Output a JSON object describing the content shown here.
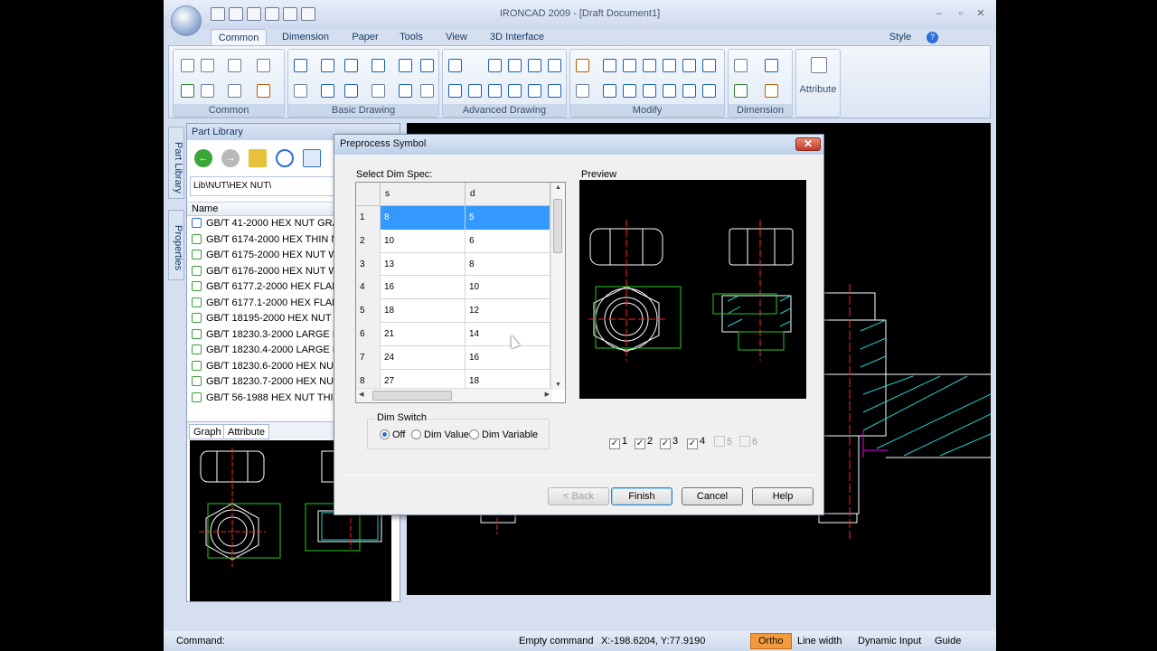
{
  "window": {
    "title": "IRONCAD 2009 - [Draft Document1]"
  },
  "ribbon": {
    "tabs": [
      "Common",
      "Dimension",
      "Paper",
      "Tools",
      "View",
      "3D Interface"
    ],
    "style_label": "Style",
    "groups": [
      "Common",
      "Basic Drawing",
      "Advanced Drawing",
      "Modify",
      "Dimension"
    ],
    "attribute_label": "Attribute"
  },
  "side_tabs": [
    "Part Library",
    "Properties"
  ],
  "part_library": {
    "title": "Part Library",
    "path": "Lib\\NUT\\HEX NUT\\",
    "column": "Name",
    "items": [
      "GB/T 41-2000 HEX NUT GRA",
      "GB/T 6174-2000 HEX THIN N",
      "GB/T 6175-2000 HEX NUT W",
      "GB/T 6176-2000 HEX NUT W",
      "GB/T 6177.2-2000 HEX FLAN",
      "GB/T 6177.1-2000 HEX FLAN",
      "GB/T 18195-2000 HEX NUT I",
      "GB/T 18230.3-2000 LARGE H",
      "GB/T 18230.4-2000 LARGE H",
      "GB/T 18230.6-2000 HEX NUT",
      "GB/T 18230.7-2000 HEX NUT",
      "GB/T 56-1988 HEX NUT THI"
    ],
    "bottom_tabs": [
      "Graph",
      "Attribute"
    ]
  },
  "dialog": {
    "title": "Preprocess Symbol",
    "close_glyph": "✕",
    "select_label": "Select Dim Spec:",
    "preview_label": "Preview",
    "columns": [
      "s",
      "d"
    ],
    "rows": [
      {
        "n": "1",
        "s": "8",
        "d": "5"
      },
      {
        "n": "2",
        "s": "10",
        "d": "6"
      },
      {
        "n": "3",
        "s": "13",
        "d": "8"
      },
      {
        "n": "4",
        "s": "16",
        "d": "10"
      },
      {
        "n": "5",
        "s": "18",
        "d": "12"
      },
      {
        "n": "6",
        "s": "21",
        "d": "14"
      },
      {
        "n": "7",
        "s": "24",
        "d": "16"
      },
      {
        "n": "8",
        "s": "27",
        "d": "18"
      }
    ],
    "dim_switch": {
      "label": "Dim Switch",
      "options": [
        "Off",
        "Dim Value",
        "Dim Variable"
      ],
      "selected": "Off"
    },
    "checks": [
      {
        "label": "1",
        "checked": true
      },
      {
        "label": "2",
        "checked": true
      },
      {
        "label": "3",
        "checked": true
      },
      {
        "label": "4",
        "checked": true
      },
      {
        "label": "5",
        "checked": false
      },
      {
        "label": "6",
        "checked": false
      }
    ],
    "buttons": {
      "back": "< Back",
      "finish": "Finish",
      "cancel": "Cancel",
      "help": "Help"
    }
  },
  "statusbar": {
    "command": "Command:",
    "state": "Empty command",
    "coords": "X:-198.6204, Y:77.9190",
    "ortho": "Ortho",
    "line_width": "Line width",
    "dynamic_input": "Dynamic Input",
    "guide": "Guide"
  },
  "colors": {
    "selection": "#3399ff",
    "ortho": "#f39a3c",
    "geometry": "#ffffff",
    "centerline": "#ff2020",
    "dimension": "#20c020",
    "hatch": "#20c0c0"
  }
}
